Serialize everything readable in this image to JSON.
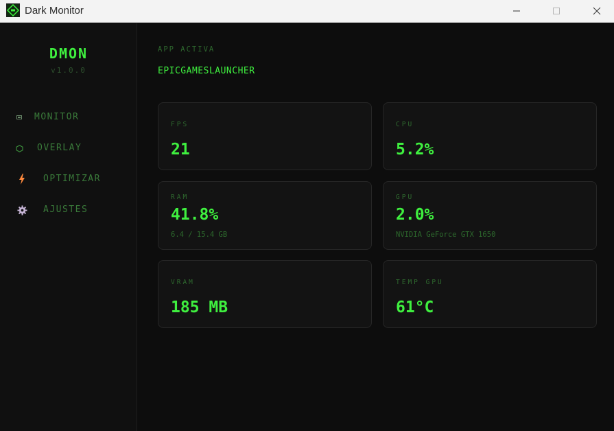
{
  "window": {
    "title": "Dark Monitor",
    "icon": "dmon-app-icon",
    "controls": [
      "minimize-icon",
      "maximize-icon",
      "close-icon"
    ]
  },
  "sidebar": {
    "brand": "DMON",
    "version": "v1.0.0",
    "items": [
      {
        "label": "MONITOR",
        "icon": "monitor-icon"
      },
      {
        "label": "OVERLAY",
        "icon": "hexagon-icon"
      },
      {
        "label": "OPTIMIZAR",
        "icon": "lightning-icon"
      },
      {
        "label": "AJUSTES",
        "icon": "gear-icon"
      }
    ]
  },
  "main": {
    "active_app_label": "APP ACTIVA",
    "active_app_name": "EPICGAMESLAUNCHER",
    "cards": {
      "fps": {
        "label": "FPS",
        "value": "21"
      },
      "cpu": {
        "label": "CPU",
        "value": "5.2%"
      },
      "ram": {
        "label": "RAM",
        "value": "41.8%",
        "sub": "6.4 / 15.4 GB"
      },
      "gpu": {
        "label": "GPU",
        "value": "2.0%",
        "sub": "NVIDIA GeForce GTX 1650"
      },
      "vram": {
        "label": "VRAM",
        "value": "185 MB"
      },
      "temp_gpu": {
        "label": "TEMP GPU",
        "value": "61°C"
      }
    }
  },
  "colors": {
    "accent": "#3ff03f",
    "muted_green": "#2f6a2f",
    "background": "#0d0d0d",
    "sidebar_bg": "#101010",
    "card_bg": "#131313",
    "optimize_icon": "#ff8a3d",
    "settings_icon": "#c9b7d9"
  }
}
